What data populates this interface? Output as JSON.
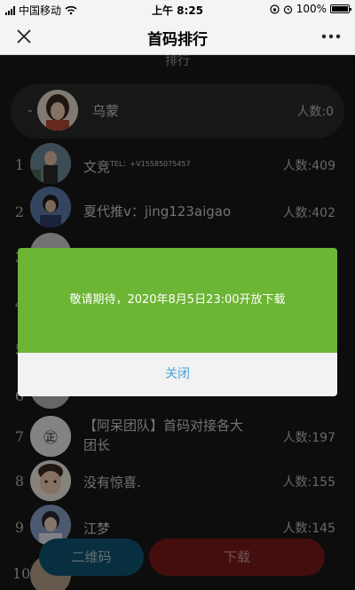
{
  "status_bar": {
    "carrier": "中国移动",
    "time": "上午 8:25",
    "battery": "100%"
  },
  "nav": {
    "title": "首码排行",
    "close_icon": "close-icon",
    "more_icon": "more-icon"
  },
  "ranking": {
    "section_title": "排行",
    "mine": {
      "rank": "-",
      "name": "乌蒙",
      "count": "人数:0"
    },
    "items": [
      {
        "rank": "1",
        "name": "文竞",
        "name_sup": "TEL：+V15585075457",
        "count": "人数:409"
      },
      {
        "rank": "2",
        "name": "夏代推v：jing123aigao",
        "count": "人数:402"
      },
      {
        "rank": "3",
        "name": "",
        "count": ""
      },
      {
        "rank": "4",
        "name": "",
        "count": ""
      },
      {
        "rank": "5",
        "name": "",
        "count": ""
      },
      {
        "rank": "6",
        "name": "",
        "count": ""
      },
      {
        "rank": "7",
        "name": "【阿呆团队】首码对接各大团长",
        "count": "人数:197"
      },
      {
        "rank": "8",
        "name": "没有惊喜.",
        "count": "人数:155"
      },
      {
        "rank": "9",
        "name": "江梦",
        "count": "人数:145"
      },
      {
        "rank": "10",
        "name": "",
        "count": ""
      }
    ]
  },
  "buttons": {
    "qr": "二维码",
    "download": "下载"
  },
  "modal": {
    "message": "敬请期待，2020年8月5日23:00开放下载",
    "close": "关闭"
  },
  "colors": {
    "modal_green": "#6db534",
    "link_blue": "#4aa0d6",
    "qr_button": "#0f5673",
    "download_button": "#7d1b1b"
  }
}
